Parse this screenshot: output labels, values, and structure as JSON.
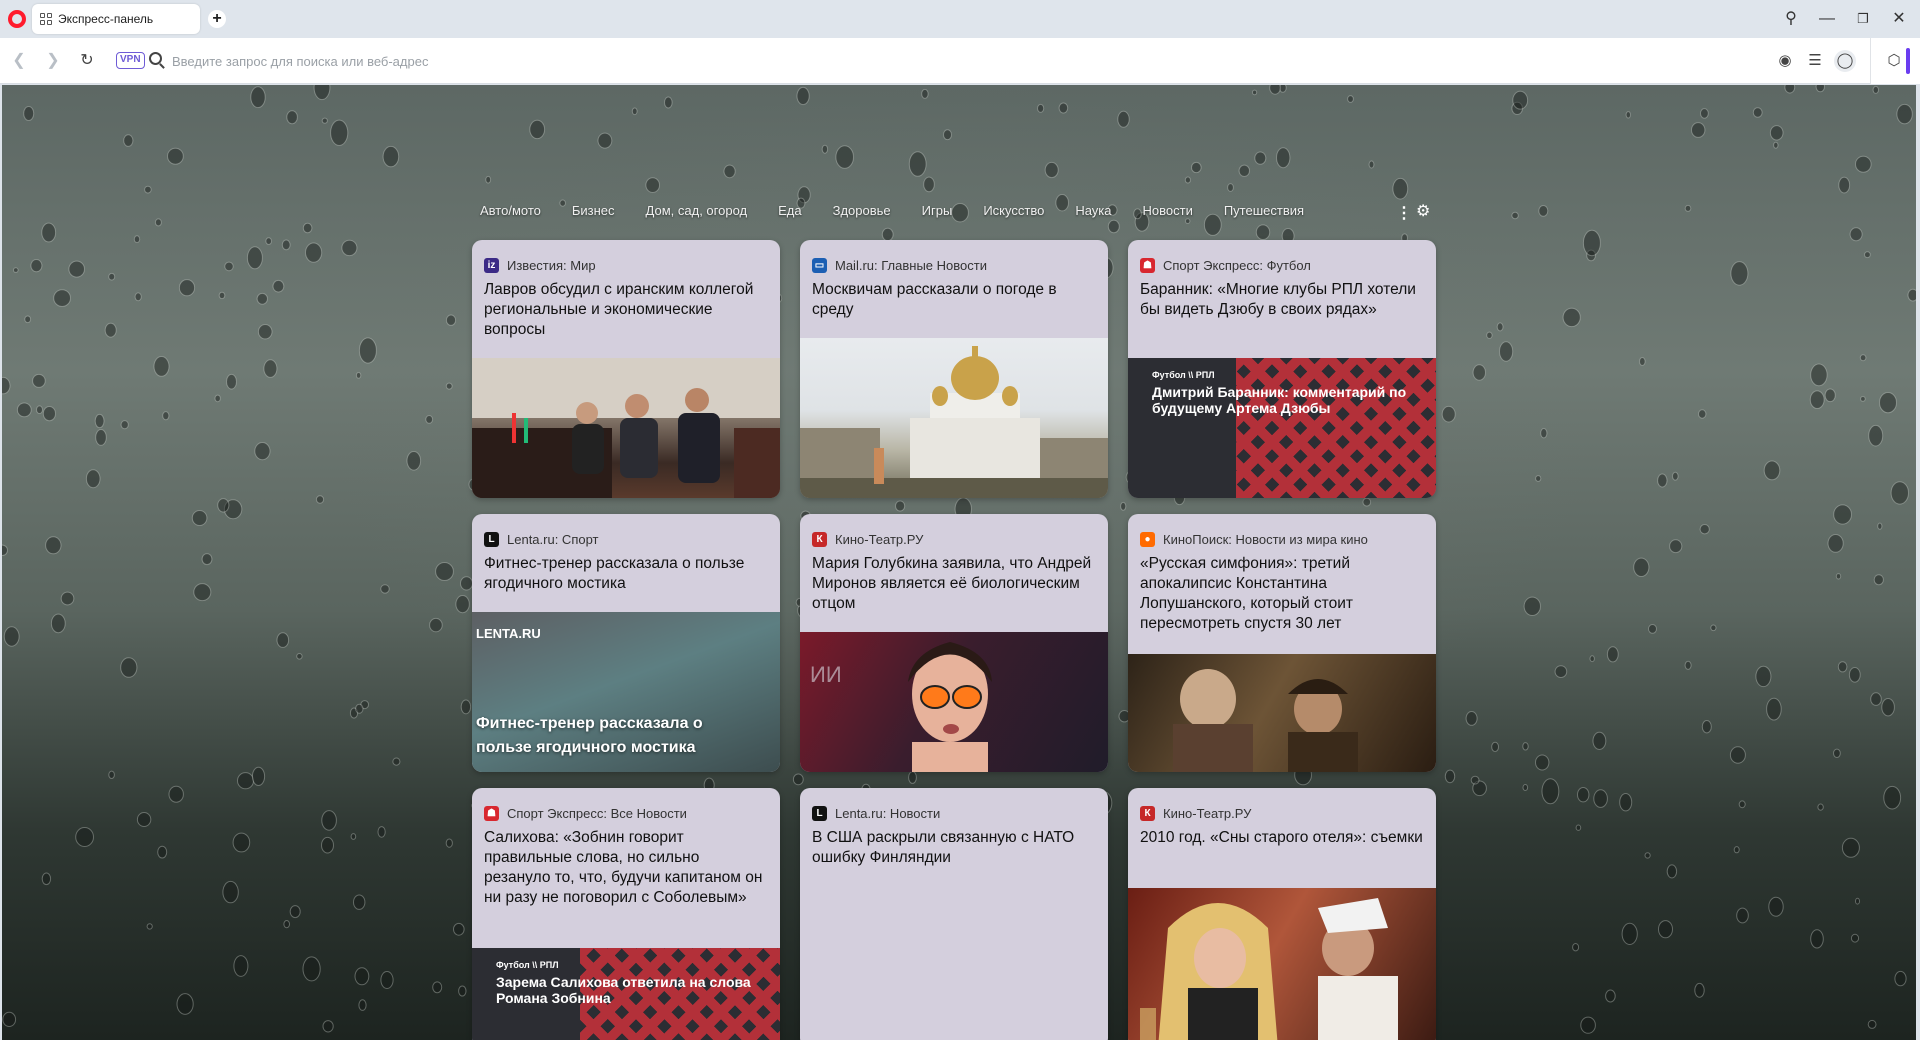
{
  "browser": {
    "tab_title": "Экспресс-панель",
    "newtab_label": "+",
    "vpn_label": "VPN",
    "address_placeholder": "Введите запрос для поиска или веб-адрес",
    "accent": "#6a3df0"
  },
  "categories": [
    "Авто/мото",
    "Бизнес",
    "Дом, сад, огород",
    "Еда",
    "Здоровье",
    "Игры",
    "Искусство",
    "Наука",
    "Новости",
    "Путешествия"
  ],
  "cards": [
    {
      "source": "Известия: Мир",
      "favicon_letter": "iz",
      "favicon_color": "#3b2a86",
      "title": "Лавров обсудил с иранским коллегой региональные и экономические вопросы",
      "image": "meeting-photo"
    },
    {
      "source": "Mail.ru: Главные Новости",
      "favicon_letter": "▭",
      "favicon_color": "#1c5fb3",
      "title": "Москвичам рассказали о погоде в среду",
      "image": "church-photo"
    },
    {
      "source": "Спорт Экспресс: Футбол",
      "favicon_letter": "☗",
      "favicon_color": "#d8272f",
      "title": "Баранник: «Многие клубы РПЛ хотели бы видеть Дзюбу в своих рядах»",
      "image_tag": "Футбол \\\\ РПЛ",
      "image_caption": "Дмитрий Баранник: комментарий по будущему Артема Дзюбы"
    },
    {
      "source": "Lenta.ru: Спорт",
      "favicon_letter": "L",
      "favicon_color": "#111111",
      "title": "Фитнес-тренер рассказала о пользе ягодичного мостика",
      "image_logo": "LENTA.RU",
      "image_caption": "Фитнес-тренер рассказала о пользе ягодичного мостика"
    },
    {
      "source": "Кино-Театр.РУ",
      "favicon_letter": "К",
      "favicon_color": "#c62828",
      "title": "Мария Голубкина заявила, что Андрей Миронов является её биологическим отцом",
      "image": "actress-photo"
    },
    {
      "source": "КиноПоиск: Новости из мира кино",
      "favicon_letter": "●",
      "favicon_color": "#ff6a00",
      "title": "«Русская симфония»: третий апокалипсис Константина Лопушанского, который стоит пересмотреть спустя 30 лет",
      "image": "film-still"
    },
    {
      "source": "Спорт Экспресс: Все Новости",
      "favicon_letter": "☗",
      "favicon_color": "#d8272f",
      "title": "Салихова: «Зобнин говорит правильные слова, но сильно резануло то, что, будучи капитаном он ни разу не поговорил с Соболевым»",
      "image_tag": "Футбол \\\\ РПЛ",
      "image_caption": "Зарема Салихова ответила на слова Романа Зобнина"
    },
    {
      "source": "Lenta.ru: Новости",
      "favicon_letter": "L",
      "favicon_color": "#111111",
      "title": "В США раскрыли связанную с НАТО ошибку Финляндии"
    },
    {
      "source": "Кино-Театр.РУ",
      "favicon_letter": "К",
      "favicon_color": "#c62828",
      "title": "2010 год. «Сны старого отеля»: съемки",
      "image": "party-photo"
    }
  ]
}
